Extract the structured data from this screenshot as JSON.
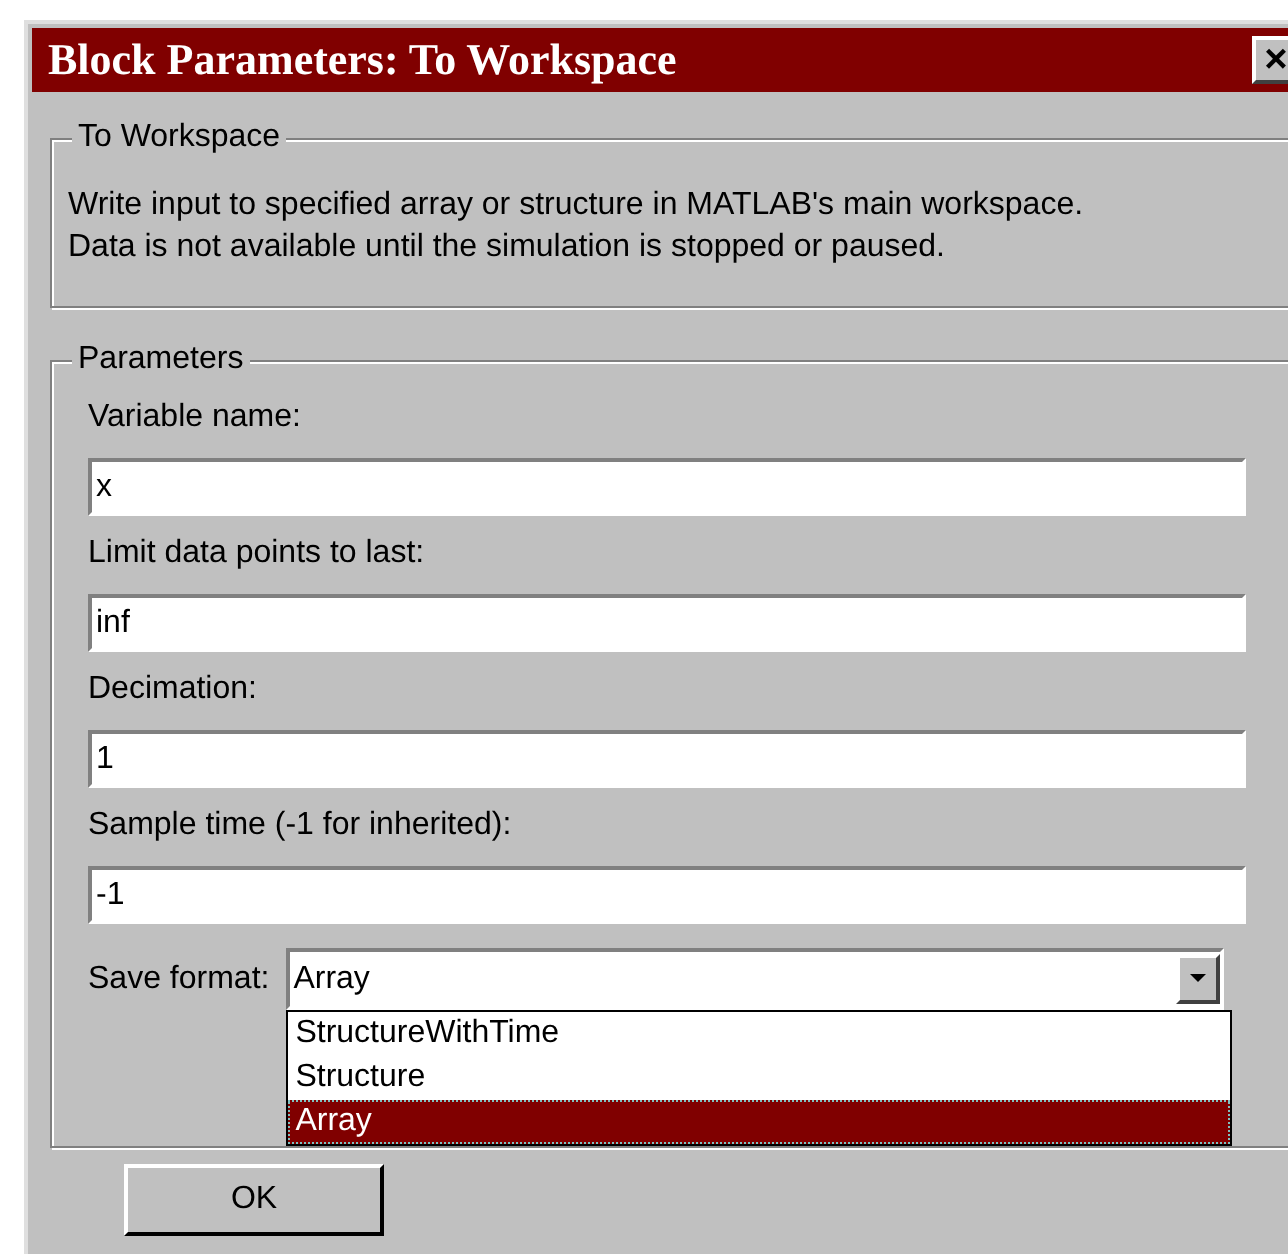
{
  "window": {
    "title": "Block Parameters: To Workspace",
    "close": "×"
  },
  "description": {
    "legend": "To Workspace",
    "text": "Write input to specified array or structure in MATLAB's main workspace.\nData is not available until the simulation is stopped or paused."
  },
  "parameters": {
    "legend": "Parameters",
    "fields": [
      {
        "label": "Variable name:",
        "value": "x"
      },
      {
        "label": "Limit data points to last:",
        "value": "inf"
      },
      {
        "label": "Decimation:",
        "value": "1"
      },
      {
        "label": "Sample time (-1 for inherited):",
        "value": "-1"
      }
    ],
    "save_format": {
      "label": "Save format:",
      "value": "Array",
      "expanded": true,
      "options": [
        {
          "label": "StructureWithTime",
          "selected": false
        },
        {
          "label": "Structure",
          "selected": false
        },
        {
          "label": "Array",
          "selected": true
        }
      ]
    }
  },
  "buttons": [
    "OK"
  ]
}
